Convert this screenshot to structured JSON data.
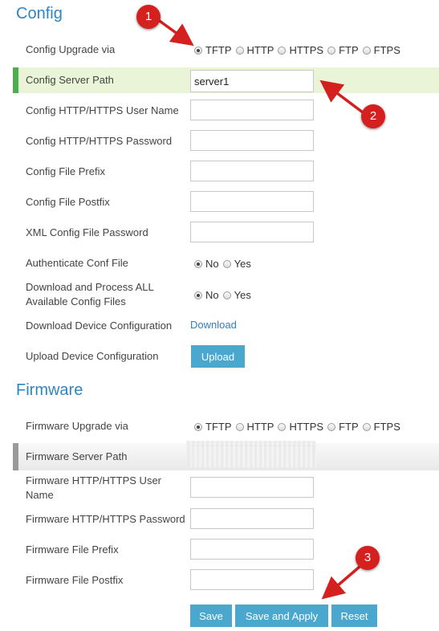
{
  "config": {
    "title": "Config",
    "upgrade_via": {
      "label": "Config Upgrade via",
      "options": [
        "TFTP",
        "HTTP",
        "HTTPS",
        "FTP",
        "FTPS"
      ],
      "selected": "TFTP"
    },
    "server_path": {
      "label": "Config Server Path",
      "value": "server1"
    },
    "user_name": {
      "label": "Config HTTP/HTTPS User Name",
      "value": ""
    },
    "password": {
      "label": "Config HTTP/HTTPS Password",
      "value": ""
    },
    "file_prefix": {
      "label": "Config File Prefix",
      "value": ""
    },
    "file_postfix": {
      "label": "Config File Postfix",
      "value": ""
    },
    "xml_password": {
      "label": "XML Config File Password",
      "value": ""
    },
    "authenticate": {
      "label": "Authenticate Conf File",
      "options": [
        "No",
        "Yes"
      ],
      "selected": "No"
    },
    "download_all": {
      "label_line1": "Download and Process ALL",
      "label_line2": "Available Config Files",
      "options": [
        "No",
        "Yes"
      ],
      "selected": "No"
    },
    "download_device": {
      "label": "Download Device Configuration",
      "link": "Download"
    },
    "upload_device": {
      "label": "Upload Device Configuration",
      "button": "Upload"
    }
  },
  "firmware": {
    "title": "Firmware",
    "upgrade_via": {
      "label": "Firmware Upgrade via",
      "options": [
        "TFTP",
        "HTTP",
        "HTTPS",
        "FTP",
        "FTPS"
      ],
      "selected": "TFTP"
    },
    "server_path": {
      "label": "Firmware Server Path",
      "value": ""
    },
    "user_name": {
      "label_line1": "Firmware HTTP/HTTPS User",
      "label_line2": "Name",
      "value": ""
    },
    "password": {
      "label": "Firmware HTTP/HTTPS Password",
      "value": ""
    },
    "file_prefix": {
      "label": "Firmware File Prefix",
      "value": ""
    },
    "file_postfix": {
      "label": "Firmware File Postfix",
      "value": ""
    }
  },
  "actions": {
    "save": "Save",
    "save_apply": "Save and Apply",
    "reset": "Reset"
  },
  "callouts": [
    "1",
    "2",
    "3"
  ],
  "colors": {
    "accent": "#2e86c1",
    "button": "#4aa8cf",
    "callout": "#d4201e",
    "highlight": "#e9f5d6",
    "highlight_border": "#4cae4c"
  }
}
